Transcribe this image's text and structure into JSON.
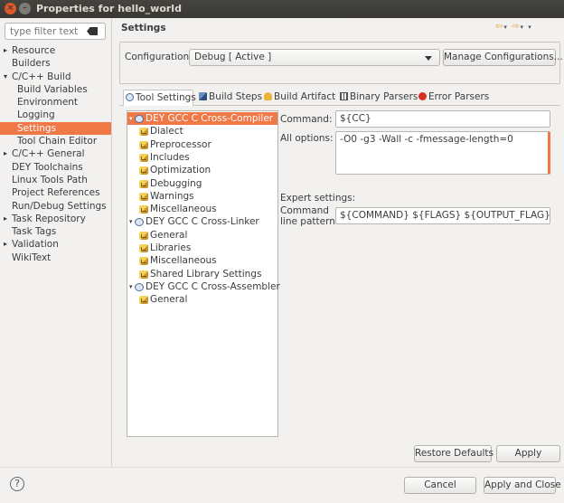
{
  "window": {
    "title": "Properties for hello_world"
  },
  "sidebar": {
    "filter_placeholder": "type filter text",
    "items": [
      {
        "label": "Resource",
        "level": 1,
        "arrow": "▸"
      },
      {
        "label": "Builders",
        "level": 1,
        "arrow": ""
      },
      {
        "label": "C/C++ Build",
        "level": 1,
        "arrow": "▾"
      },
      {
        "label": "Build Variables",
        "level": 2,
        "arrow": ""
      },
      {
        "label": "Environment",
        "level": 2,
        "arrow": ""
      },
      {
        "label": "Logging",
        "level": 2,
        "arrow": ""
      },
      {
        "label": "Settings",
        "level": 2,
        "arrow": "",
        "selected": true
      },
      {
        "label": "Tool Chain Editor",
        "level": 2,
        "arrow": ""
      },
      {
        "label": "C/C++ General",
        "level": 1,
        "arrow": "▸"
      },
      {
        "label": "DEY Toolchains",
        "level": 1,
        "arrow": ""
      },
      {
        "label": "Linux Tools Path",
        "level": 1,
        "arrow": ""
      },
      {
        "label": "Project References",
        "level": 1,
        "arrow": ""
      },
      {
        "label": "Run/Debug Settings",
        "level": 1,
        "arrow": ""
      },
      {
        "label": "Task Repository",
        "level": 1,
        "arrow": "▸"
      },
      {
        "label": "Task Tags",
        "level": 1,
        "arrow": ""
      },
      {
        "label": "Validation",
        "level": 1,
        "arrow": "▸"
      },
      {
        "label": "WikiText",
        "level": 1,
        "arrow": ""
      }
    ]
  },
  "settings": {
    "title": "Settings",
    "configuration_label": "Configuration:",
    "configuration_value": "Debug  [ Active ]",
    "manage_button": "Manage Configurations...",
    "tabs": [
      {
        "label": "Tool Settings",
        "icon": "tool-settings-icon",
        "active": true
      },
      {
        "label": "Build Steps",
        "icon": "build-steps-icon"
      },
      {
        "label": "Build Artifact",
        "icon": "build-artifact-icon"
      },
      {
        "label": "Binary Parsers",
        "icon": "binary-parsers-icon"
      },
      {
        "label": "Error Parsers",
        "icon": "error-parsers-icon"
      }
    ],
    "tree": [
      {
        "label": "DEY GCC C Cross-Compiler",
        "type": "tool",
        "selected": true
      },
      {
        "label": "Dialect",
        "type": "option"
      },
      {
        "label": "Preprocessor",
        "type": "option"
      },
      {
        "label": "Includes",
        "type": "option"
      },
      {
        "label": "Optimization",
        "type": "option"
      },
      {
        "label": "Debugging",
        "type": "option"
      },
      {
        "label": "Warnings",
        "type": "option"
      },
      {
        "label": "Miscellaneous",
        "type": "option"
      },
      {
        "label": "DEY GCC C Cross-Linker",
        "type": "tool"
      },
      {
        "label": "General",
        "type": "option"
      },
      {
        "label": "Libraries",
        "type": "option"
      },
      {
        "label": "Miscellaneous",
        "type": "option"
      },
      {
        "label": "Shared Library Settings",
        "type": "option"
      },
      {
        "label": "DEY GCC C Cross-Assembler",
        "type": "tool"
      },
      {
        "label": "General",
        "type": "option"
      }
    ],
    "command_label": "Command:",
    "command_value": "${CC}",
    "all_options_label": "All options:",
    "all_options_value": "-O0 -g3 -Wall -c -fmessage-length=0",
    "expert_label": "Expert settings:",
    "pattern_label_1": "Command",
    "pattern_label_2": "line pattern:",
    "pattern_value": "${COMMAND} ${FLAGS} ${OUTPUT_FLAG} ${OUTPUT_PREFIX}${OUTPUT} ${INPUTS}",
    "restore_button": "Restore Defaults",
    "apply_button": "Apply"
  },
  "footer": {
    "help_glyph": "?",
    "cancel_button": "Cancel",
    "apply_close_button": "Apply and Close"
  },
  "colors": {
    "accent": "#f07746",
    "titlebar": "#3d3c38",
    "background": "#f2f1f0"
  }
}
